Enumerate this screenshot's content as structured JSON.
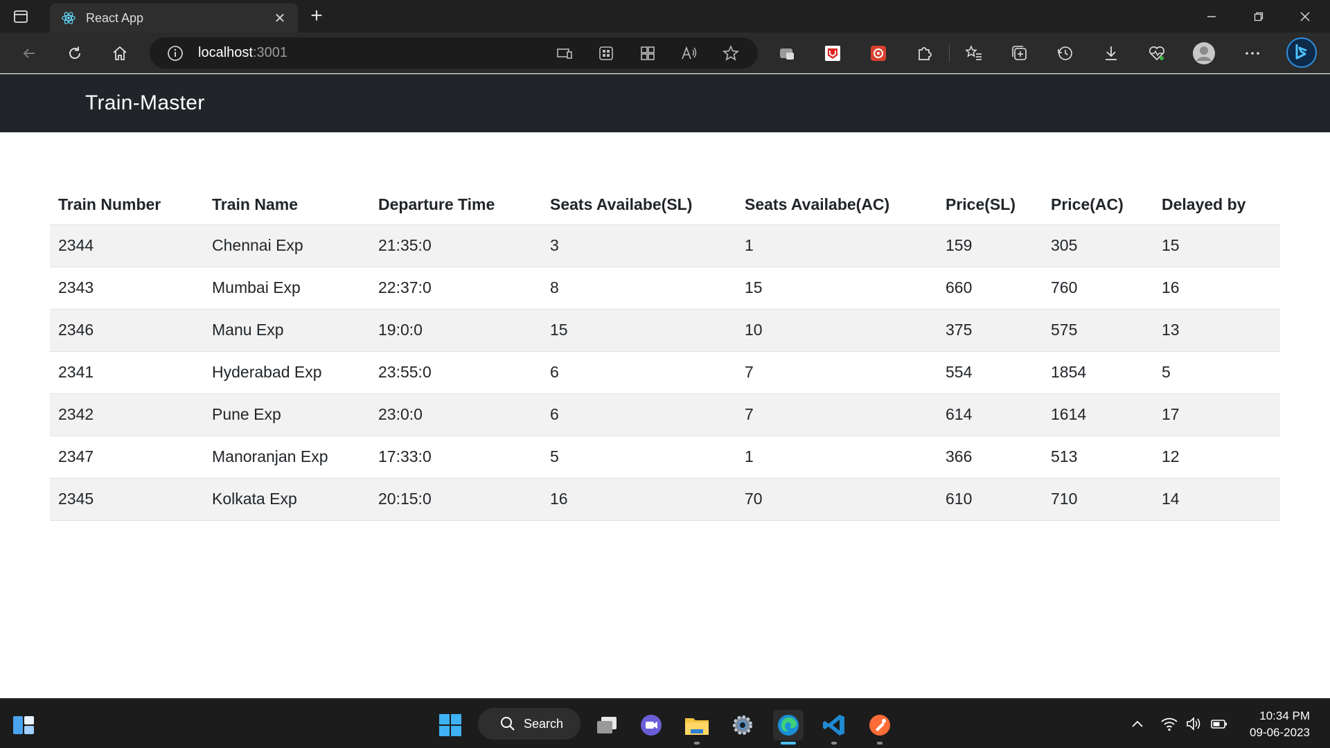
{
  "browser": {
    "tab_title": "React App",
    "url_host": "localhost",
    "url_port": ":3001"
  },
  "app": {
    "brand": "Train-Master"
  },
  "table": {
    "headers": [
      "Train Number",
      "Train Name",
      "Departure Time",
      "Seats Availabe(SL)",
      "Seats Availabe(AC)",
      "Price(SL)",
      "Price(AC)",
      "Delayed by"
    ],
    "rows": [
      [
        "2344",
        "Chennai Exp",
        "21:35:0",
        "3",
        "1",
        "159",
        "305",
        "15"
      ],
      [
        "2343",
        "Mumbai Exp",
        "22:37:0",
        "8",
        "15",
        "660",
        "760",
        "16"
      ],
      [
        "2346",
        "Manu Exp",
        "19:0:0",
        "15",
        "10",
        "375",
        "575",
        "13"
      ],
      [
        "2341",
        "Hyderabad Exp",
        "23:55:0",
        "6",
        "7",
        "554",
        "1854",
        "5"
      ],
      [
        "2342",
        "Pune Exp",
        "23:0:0",
        "6",
        "7",
        "614",
        "1614",
        "17"
      ],
      [
        "2347",
        "Manoranjan Exp",
        "17:33:0",
        "5",
        "1",
        "366",
        "513",
        "12"
      ],
      [
        "2345",
        "Kolkata Exp",
        "20:15:0",
        "16",
        "70",
        "610",
        "710",
        "14"
      ]
    ]
  },
  "taskbar": {
    "search_label": "Search",
    "time": "10:34 PM",
    "date": "09-06-2023"
  },
  "colors": {
    "navbar_bg": "#212529",
    "stripe_bg": "#f2f2f2",
    "chrome_dark": "#202020",
    "accent": "#4cc2ff"
  }
}
